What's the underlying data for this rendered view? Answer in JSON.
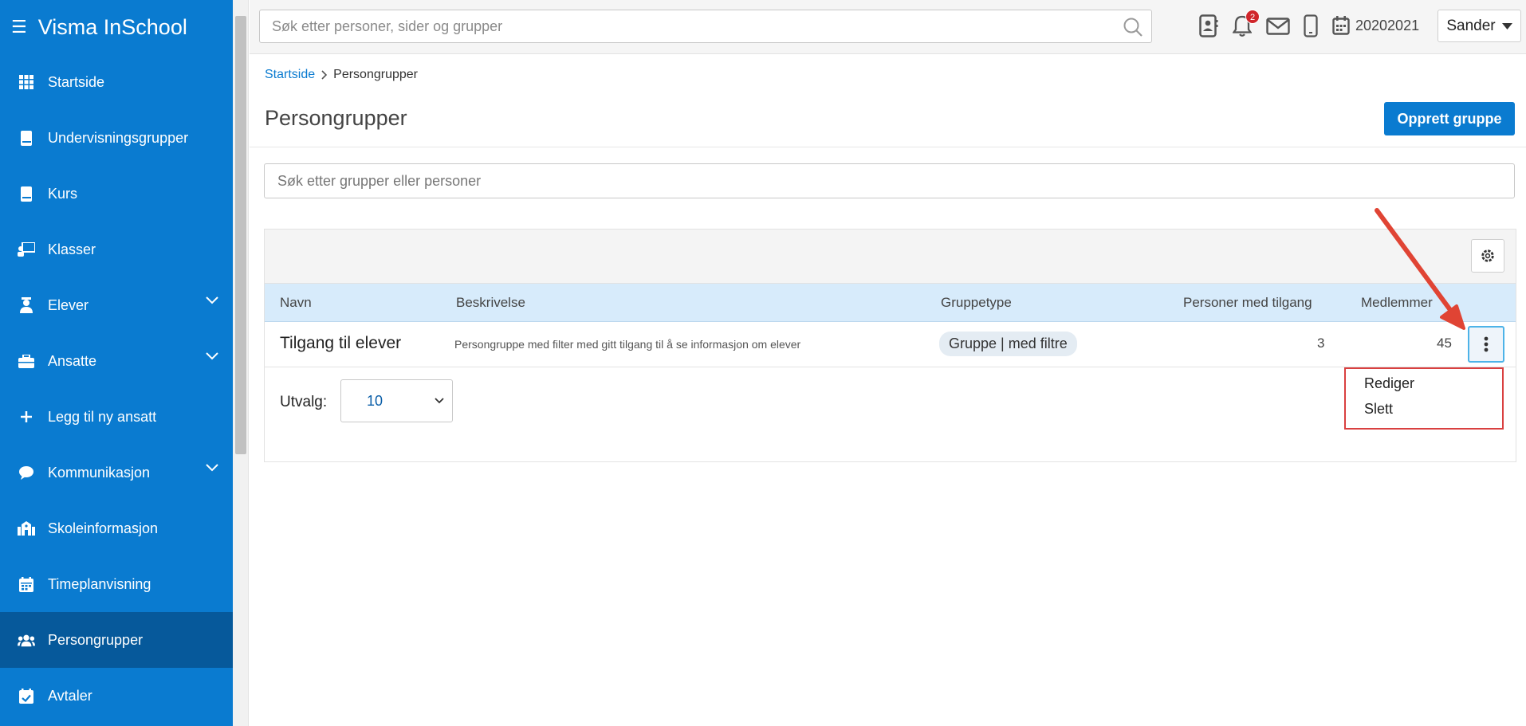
{
  "app": {
    "title": "Visma InSchool"
  },
  "sidebar": {
    "items": [
      {
        "label": "Startside",
        "icon": "grid-icon"
      },
      {
        "label": "Undervisningsgrupper",
        "icon": "book-icon"
      },
      {
        "label": "Kurs",
        "icon": "book-icon"
      },
      {
        "label": "Klasser",
        "icon": "presentation-icon"
      },
      {
        "label": "Elever",
        "icon": "student-icon",
        "expandable": true
      },
      {
        "label": "Ansatte",
        "icon": "briefcase-icon",
        "expandable": true
      },
      {
        "label": "Legg til ny ansatt",
        "icon": "plus-icon"
      },
      {
        "label": "Kommunikasjon",
        "icon": "chat-icon",
        "expandable": true
      },
      {
        "label": "Skoleinformasjon",
        "icon": "school-icon"
      },
      {
        "label": "Timeplanvisning",
        "icon": "calendar-icon"
      },
      {
        "label": "Persongrupper",
        "icon": "users-icon",
        "active": true
      },
      {
        "label": "Avtaler",
        "icon": "calendar-check-icon"
      }
    ]
  },
  "topbar": {
    "search_placeholder": "Søk etter personer, sider og grupper",
    "notification_count": "2",
    "school_year": "20202021",
    "user_name": "Sander"
  },
  "breadcrumb": {
    "home": "Startside",
    "current": "Persongrupper"
  },
  "page": {
    "title": "Persongrupper",
    "create_button": "Opprett gruppe",
    "search_placeholder": "Søk etter grupper eller personer"
  },
  "table": {
    "columns": [
      "Navn",
      "Beskrivelse",
      "Gruppetype",
      "Personer med tilgang",
      "Medlemmer"
    ],
    "rows": [
      {
        "name": "Tilgang til elever",
        "description": "Persongruppe med filter med gitt tilgang til å se informasjon om elever",
        "type": "Gruppe | med filtre",
        "access_count": "3",
        "members": "45"
      }
    ]
  },
  "pagination": {
    "label": "Utvalg:",
    "page_size": "10"
  },
  "row_menu": {
    "items": [
      "Rediger",
      "Slett"
    ]
  },
  "colors": {
    "brand": "#0a7bd0",
    "active_nav": "#06599b",
    "annotation": "#e04434"
  }
}
